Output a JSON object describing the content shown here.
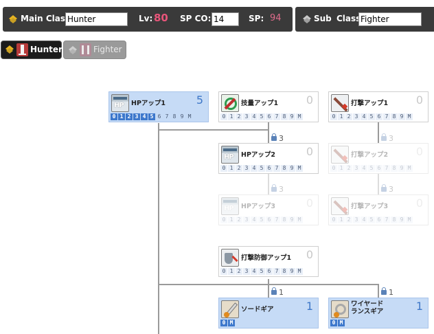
{
  "header": {
    "main_class_label": "Main Class",
    "main_class_value": "Hunter",
    "lv_label": "Lv:",
    "lv_value": "80",
    "spco_label": "SP CO:",
    "spco_value": "14",
    "sp_label": "SP:",
    "sp_value": "94",
    "sub_label_1": "Sub",
    "sub_label_2": "Class",
    "sub_class_value": "Fighter"
  },
  "class_tabs": [
    {
      "label": "Hunter",
      "active": true
    },
    {
      "label": "Fighter",
      "active": false
    }
  ],
  "level_digits": [
    "0",
    "1",
    "2",
    "3",
    "4",
    "5",
    "6",
    "7",
    "8",
    "9",
    "M"
  ],
  "short_digits": [
    "0",
    "M"
  ],
  "skills": {
    "hp_up_1": {
      "name": "HPアップ1",
      "level": "5",
      "level_num": 5
    },
    "tech_up_1": {
      "name": "技量アップ1",
      "level": "0",
      "level_num": 0
    },
    "strike_up_1": {
      "name": "打撃アップ1",
      "level": "0",
      "level_num": 0
    },
    "hp_up_2": {
      "name": "HPアップ2",
      "level": "0",
      "level_num": 0
    },
    "strike_up_2": {
      "name": "打撃アップ2",
      "level": "0",
      "level_num": 0
    },
    "hp_up_3": {
      "name": "HPアップ3",
      "level": "0",
      "level_num": 0
    },
    "strike_up_3": {
      "name": "打撃アップ3",
      "level": "0",
      "level_num": 0
    },
    "strike_def_up_1": {
      "name": "打撃防御アップ1",
      "level": "0",
      "level_num": 0
    },
    "sword_gear": {
      "name": "ソードギア",
      "level": "1",
      "level_num": 1
    },
    "wired_lance_gear": {
      "name_line1": "ワイヤード",
      "name_line2": "ランスギア",
      "level": "1",
      "level_num": 1
    }
  },
  "requirements": {
    "hp2_req": "3",
    "strike2_req": "3",
    "hp3_req": "3",
    "strike3_req": "3",
    "sword_gear_req": "1",
    "lance_gear_req": "1"
  },
  "colors": {
    "header_bg": "#3a3a3a",
    "accent_pink": "#e8557a",
    "selected_card": "#c6dbf6",
    "level_on": "#3d78cc"
  }
}
